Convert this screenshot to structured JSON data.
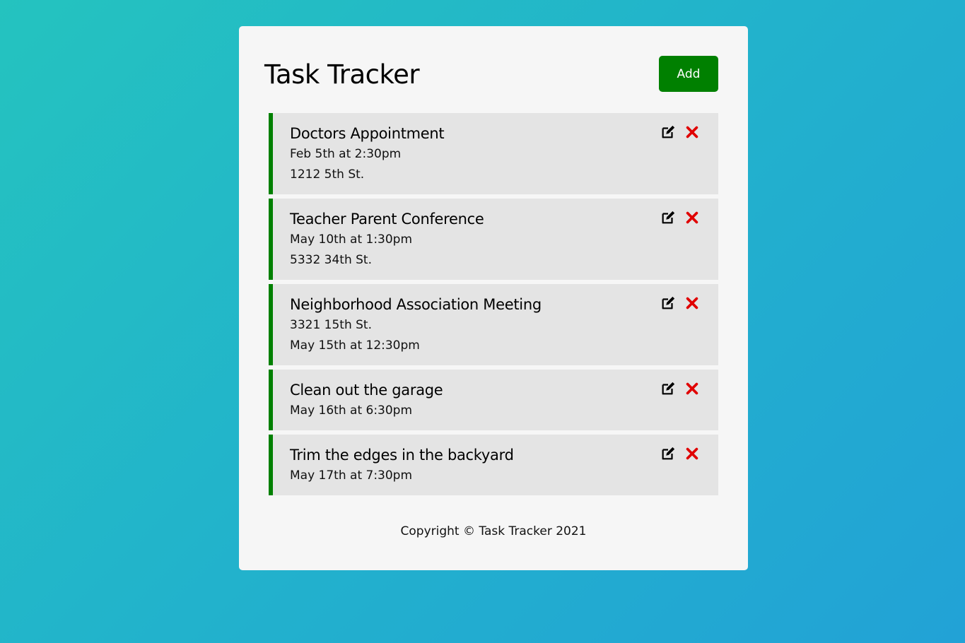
{
  "app": {
    "title": "Task Tracker",
    "add_label": "Add",
    "footer": "Copyright © Task Tracker 2021"
  },
  "colors": {
    "accent": "#008000",
    "delete": "#e00000",
    "card_bg": "#f6f6f6",
    "task_bg": "#e4e4e4"
  },
  "tasks": [
    {
      "title": "Doctors Appointment",
      "lines": [
        "Feb 5th at 2:30pm",
        "1212 5th St."
      ]
    },
    {
      "title": "Teacher Parent Conference",
      "lines": [
        "May 10th at 1:30pm",
        "5332 34th St."
      ]
    },
    {
      "title": "Neighborhood Association Meeting",
      "lines": [
        "3321 15th St.",
        "May 15th at 12:30pm"
      ]
    },
    {
      "title": "Clean out the garage",
      "lines": [
        "May 16th at 6:30pm"
      ]
    },
    {
      "title": "Trim the edges in the backyard",
      "lines": [
        "May 17th at 7:30pm"
      ]
    }
  ],
  "icons": {
    "edit": "edit-icon",
    "delete": "close-icon"
  }
}
